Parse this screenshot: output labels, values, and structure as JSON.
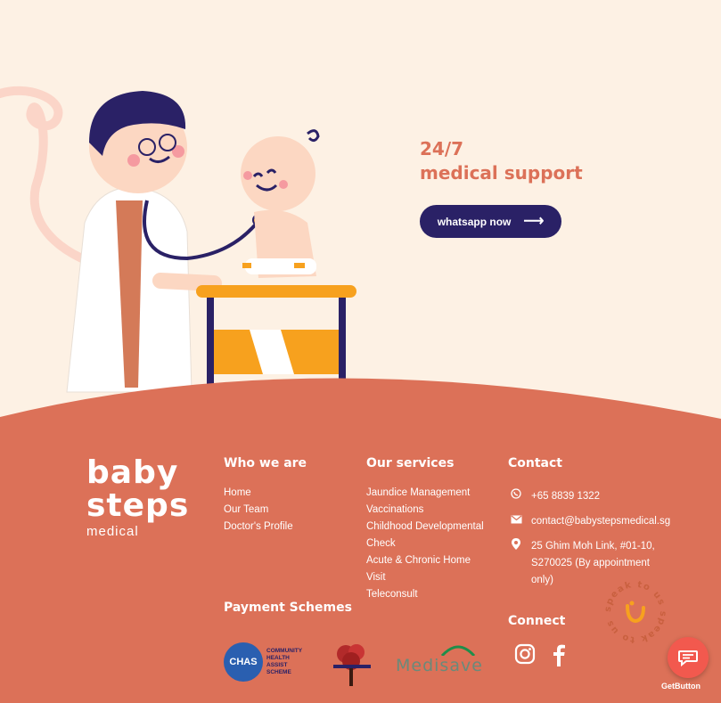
{
  "hero": {
    "headline_line1": "24/7",
    "headline_line2": "medical support",
    "cta_label": "whatsapp now",
    "cta_arrow": "⟶"
  },
  "logo": {
    "line1": "baby",
    "line2": "steps",
    "line3": "medical"
  },
  "footer": {
    "who_we_are": {
      "title": "Who we are",
      "links": [
        "Home",
        "Our Team",
        "Doctor's Profile"
      ]
    },
    "services": {
      "title": "Our services",
      "links": [
        "Jaundice Management",
        "Vaccinations",
        "Childhood Developmental",
        "Check",
        "Acute & Chronic Home",
        "Visit",
        "Teleconsult"
      ]
    },
    "contact": {
      "title": "Contact",
      "phone": "+65 8839 1322",
      "email": "contact@babystepsmedical.sg",
      "address_line1": "25 Ghim Moh Link, #01-10,",
      "address_line2": "S270025 (By appointment",
      "address_line3": "only)"
    },
    "payment": {
      "title": "Payment Schemes",
      "chas_line1": "COMMUNITY",
      "chas_line2": "HEALTH",
      "chas_line3": "ASSIST",
      "chas_line4": "SCHEME",
      "chas_badge": "CHAS",
      "medisave": "Medisave"
    },
    "connect": {
      "title": "Connect"
    }
  },
  "widget": {
    "badge_text": "speak to us speak to us",
    "getbutton_label": "GetButton"
  },
  "colors": {
    "cream": "#fdf1e4",
    "coral": "#dc7158",
    "navy": "#2a2166",
    "orange": "#f7a11e",
    "fab_red": "#f2594e"
  }
}
